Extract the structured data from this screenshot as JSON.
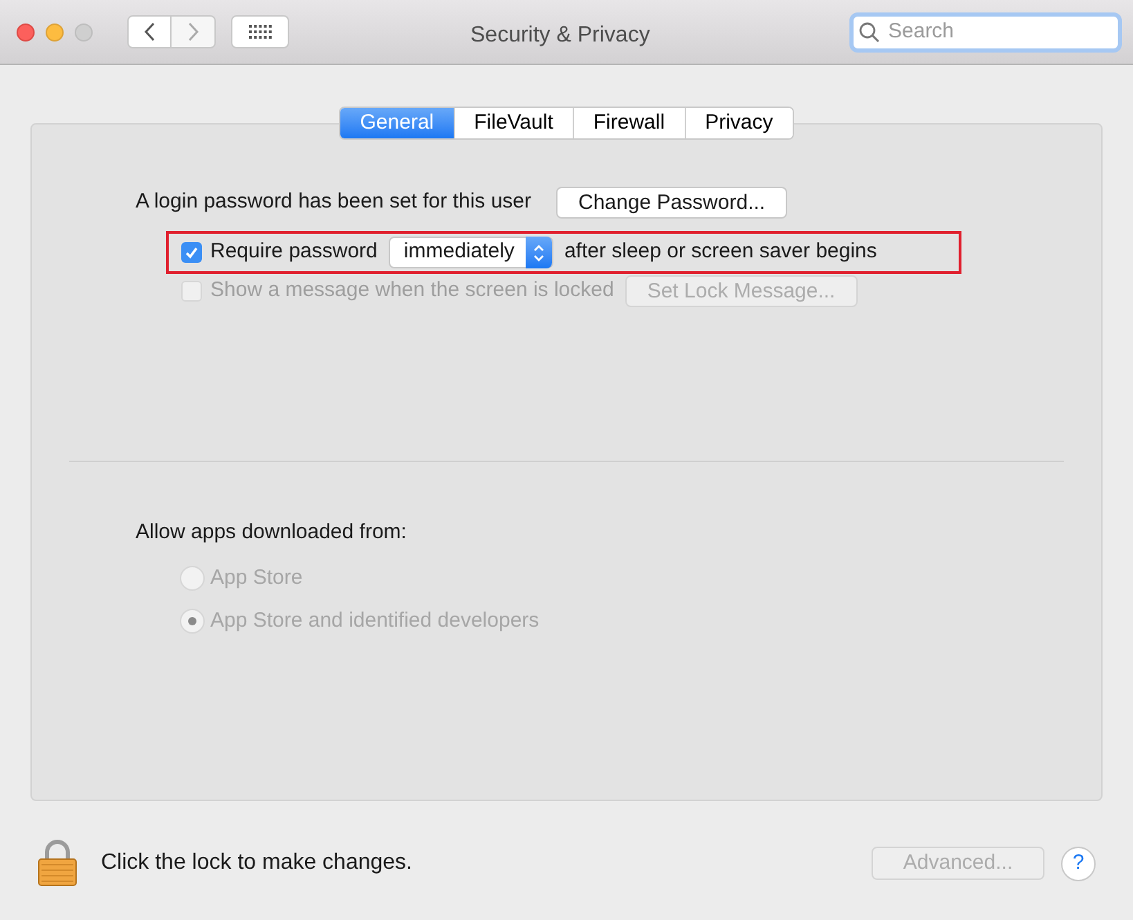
{
  "window": {
    "title": "Security & Privacy"
  },
  "search": {
    "placeholder": "Search"
  },
  "tabs": [
    {
      "label": "General",
      "selected": true
    },
    {
      "label": "FileVault",
      "selected": false
    },
    {
      "label": "Firewall",
      "selected": false
    },
    {
      "label": "Privacy",
      "selected": false
    }
  ],
  "login": {
    "text": "A login password has been set for this user",
    "button": "Change Password..."
  },
  "require_password": {
    "checked": true,
    "disabled": false,
    "highlighted": true,
    "label": "Require password",
    "value": "immediately",
    "suffix": "after sleep or screen saver begins"
  },
  "lock_message": {
    "checked": false,
    "disabled": true,
    "label": "Show a message when the screen is locked",
    "button": "Set Lock Message..."
  },
  "allow_apps": {
    "label": "Allow apps downloaded from:",
    "options": [
      {
        "label": "App Store",
        "selected": false,
        "disabled": true
      },
      {
        "label": "App Store and identified developers",
        "selected": true,
        "disabled": true
      }
    ]
  },
  "footer": {
    "lock_text": "Click the lock to make changes.",
    "advanced": "Advanced...",
    "advanced_disabled": true,
    "help": "?"
  }
}
